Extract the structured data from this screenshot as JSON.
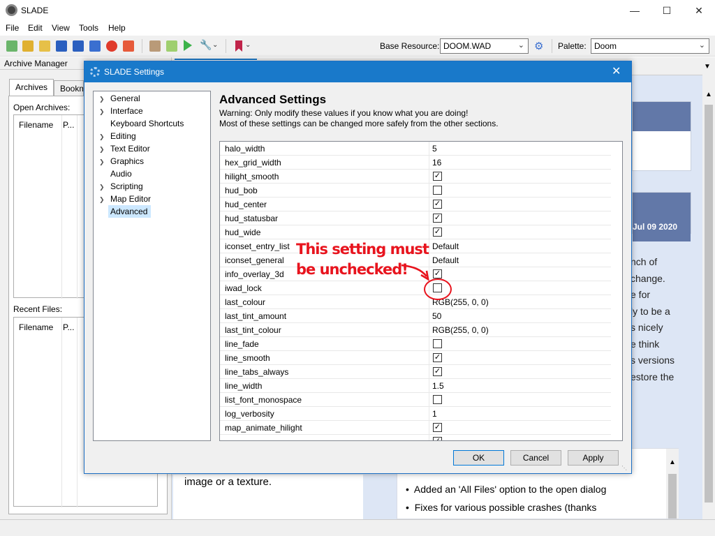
{
  "window": {
    "title": "SLADE",
    "minimize_icon": "minimize-icon",
    "maximize_icon": "maximize-icon",
    "close_icon": "close-icon"
  },
  "menu": [
    "File",
    "Edit",
    "View",
    "Tools",
    "Help"
  ],
  "toolbar": {
    "base_resource_label": "Base Resource:",
    "base_resource_value": "DOOM.WAD",
    "palette_label": "Palette:",
    "palette_value": "Doom"
  },
  "archive_manager": {
    "title": "Archive Manager",
    "tabs": [
      "Archives",
      "Bookm"
    ],
    "open_archives_label": "Open Archives:",
    "recent_files_label": "Recent Files:",
    "columns": [
      "Filename",
      "P..."
    ]
  },
  "background_page": {
    "date": "Jul 09 2020",
    "text_lines": [
      "nch of",
      "change.",
      "e for",
      "ly to be a",
      "s nicely",
      "e think",
      "s versions",
      "estore the"
    ],
    "left_text": "image or a texture.",
    "bullets": [
      "Added an 'All Files' option to the open dialog",
      "Fixes for various possible crashes (thanks"
    ]
  },
  "dialog": {
    "title": "SLADE Settings",
    "tree": [
      {
        "label": "General",
        "expandable": true
      },
      {
        "label": "Interface",
        "expandable": true
      },
      {
        "label": "Keyboard Shortcuts",
        "expandable": false
      },
      {
        "label": "Editing",
        "expandable": true
      },
      {
        "label": "Text Editor",
        "expandable": true
      },
      {
        "label": "Graphics",
        "expandable": true
      },
      {
        "label": "Audio",
        "expandable": false
      },
      {
        "label": "Scripting",
        "expandable": true
      },
      {
        "label": "Map Editor",
        "expandable": true
      },
      {
        "label": "Advanced",
        "expandable": false,
        "selected": true
      }
    ],
    "heading": "Advanced Settings",
    "warning_line1": "Warning: Only modify these values if you know what you are doing!",
    "warning_line2": "Most of these settings can be changed more safely from the other sections.",
    "settings": [
      {
        "name": "halo_width",
        "value": "5"
      },
      {
        "name": "hex_grid_width",
        "value": "16"
      },
      {
        "name": "hilight_smooth",
        "checked": true
      },
      {
        "name": "hud_bob",
        "checked": false
      },
      {
        "name": "hud_center",
        "checked": true
      },
      {
        "name": "hud_statusbar",
        "checked": true
      },
      {
        "name": "hud_wide",
        "checked": true
      },
      {
        "name": "iconset_entry_list",
        "value": "Default"
      },
      {
        "name": "iconset_general",
        "value": "Default"
      },
      {
        "name": "info_overlay_3d",
        "checked": true
      },
      {
        "name": "iwad_lock",
        "checked": false
      },
      {
        "name": "last_colour",
        "value": "RGB(255, 0, 0)"
      },
      {
        "name": "last_tint_amount",
        "value": "50"
      },
      {
        "name": "last_tint_colour",
        "value": "RGB(255, 0, 0)"
      },
      {
        "name": "line_fade",
        "checked": false
      },
      {
        "name": "line_smooth",
        "checked": true
      },
      {
        "name": "line_tabs_always",
        "checked": true
      },
      {
        "name": "line_width",
        "value": "1.5"
      },
      {
        "name": "list_font_monospace",
        "checked": false
      },
      {
        "name": "log_verbosity",
        "value": "1"
      },
      {
        "name": "map_animate_hilight",
        "checked": true
      },
      {
        "name": "",
        "checked": true
      }
    ],
    "annotation_line1": "This setting must",
    "annotation_line2": "be unchecked!",
    "ok_label": "OK",
    "cancel_label": "Cancel",
    "apply_label": "Apply"
  },
  "colors": {
    "dialog_title_bar": "#1979ca",
    "annotation_red": "#e8141e",
    "selection_blue": "#cce8ff"
  }
}
